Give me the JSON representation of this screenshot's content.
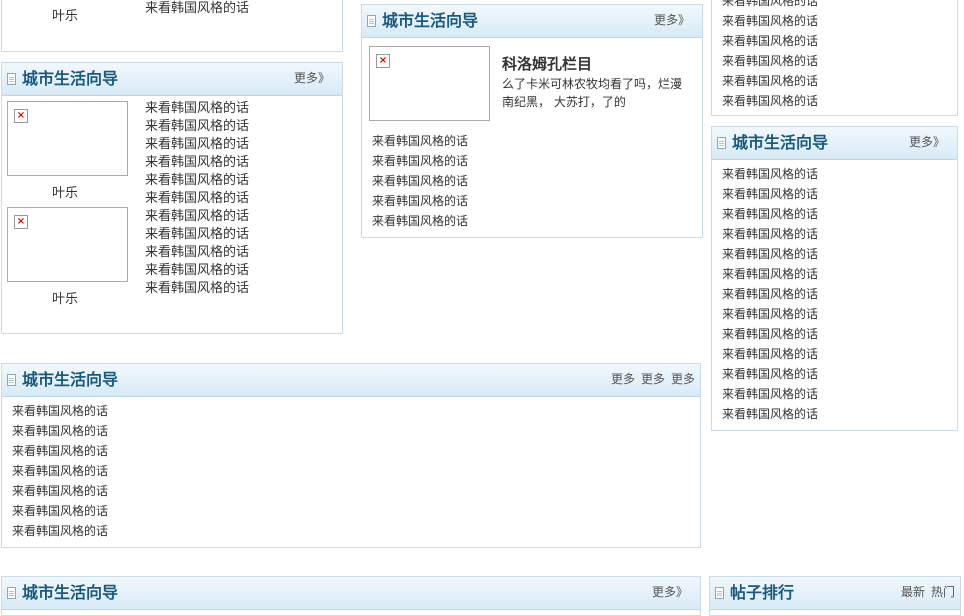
{
  "top_left_partial": {
    "caption": "叶乐",
    "line": "来看韩国风格的话"
  },
  "left_panel": {
    "title": "城市生活向导",
    "more": "更多》",
    "captions": [
      "叶乐",
      "叶乐"
    ],
    "items": [
      "来看韩国风格的话",
      "来看韩国风格的话",
      "来看韩国风格的话",
      "来看韩国风格的话",
      "来看韩国风格的话",
      "来看韩国风格的话",
      "来看韩国风格的话",
      "来看韩国风格的话",
      "来看韩国风格的话",
      "来看韩国风格的话",
      "来看韩国风格的话"
    ]
  },
  "center_panel": {
    "title": "城市生活向导",
    "more": "更多》",
    "feature_title": "科洛姆孔栏目",
    "feature_desc": "么了卡米可林农牧均看了吗，烂漫南纪黑， 大苏打，了的",
    "items": [
      "来看韩国风格的话",
      "来看韩国风格的话",
      "来看韩国风格的话",
      "来看韩国风格的话",
      "来看韩国风格的话"
    ]
  },
  "right_top_partial": {
    "items": [
      "来看韩国风格的话",
      "来看韩国风格的话",
      "来看韩国风格的话",
      "来看韩国风格的话",
      "来看韩国风格的话",
      "来看韩国风格的话"
    ]
  },
  "right_panel": {
    "title": "城市生活向导",
    "more": "更多》",
    "items": [
      "来看韩国风格的话",
      "来看韩国风格的话",
      "来看韩国风格的话",
      "来看韩国风格的话",
      "来看韩国风格的话",
      "来看韩国风格的话",
      "来看韩国风格的话",
      "来看韩国风格的话",
      "来看韩国风格的话",
      "来看韩国风格的话",
      "来看韩国风格的话",
      "来看韩国风格的话",
      "来看韩国风格的话"
    ]
  },
  "wide_panel": {
    "title": "城市生活向导",
    "more_links": [
      "更多",
      "更多",
      "更多"
    ],
    "items": [
      "来看韩国风格的话",
      "来看韩国风格的话",
      "来看韩国风格的话",
      "来看韩国风格的话",
      "来看韩国风格的话",
      "来看韩国风格的话",
      "来看韩国风格的话"
    ]
  },
  "bottom_panel": {
    "title": "城市生活向导",
    "more": "更多》"
  },
  "ranking_panel": {
    "title": "帖子排行",
    "tabs": [
      "最新",
      "热门"
    ]
  }
}
